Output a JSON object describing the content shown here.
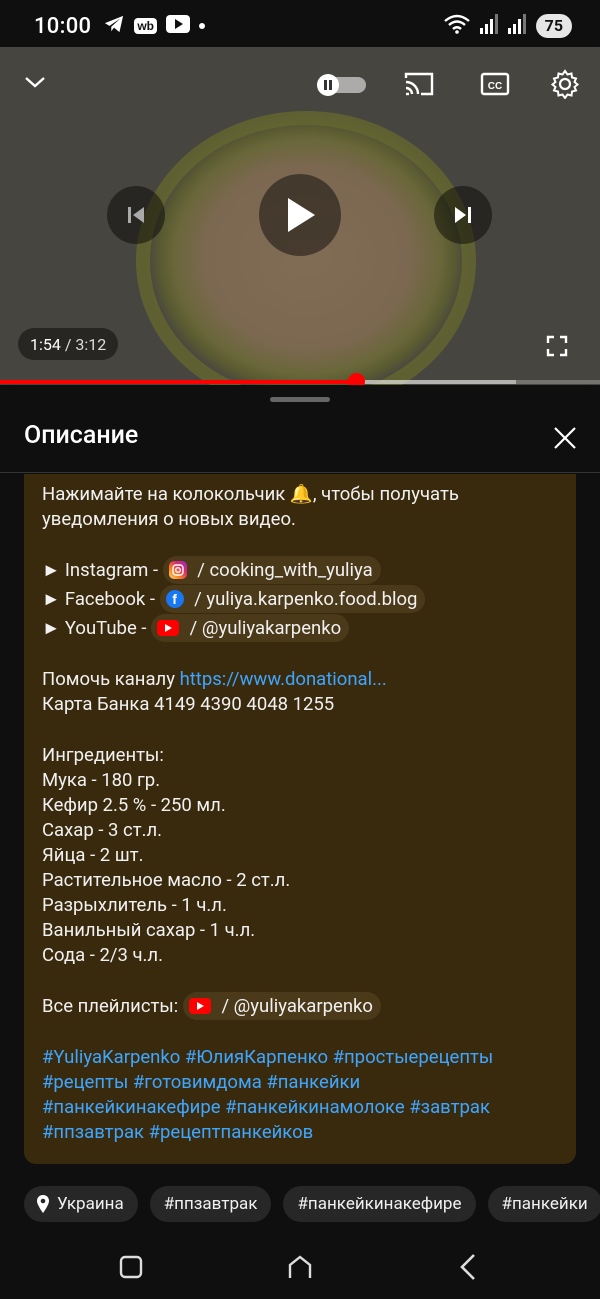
{
  "status_bar": {
    "time": "10:00",
    "battery": "75"
  },
  "player": {
    "current_time": "1:54",
    "separator": " / ",
    "duration": "3:12",
    "played_fraction": 0.593,
    "buffered_fraction": 0.86
  },
  "description_sheet": {
    "title": "Описание",
    "text": {
      "bell_line1": "Нажимайте на колокольчик 🔔, чтобы получать",
      "bell_line2": "уведомления о новых видео.",
      "instagram_prefix": "► Instagram - ",
      "instagram_handle": " / cooking_with_yuliya",
      "facebook_prefix": "► Facebook - ",
      "facebook_handle": " / yuliya.karpenko.food.blog",
      "youtube_prefix": "► YouTube - ",
      "youtube_handle": " / @yuliyakarpenko",
      "help_label": "Помочь каналу ",
      "help_link": "https://www.donational...",
      "bank_card": "Карта Банка 4149 4390 4048 1255",
      "ingredients_title": "Ингредиенты:",
      "ingredients": [
        "Мука - 180 гр.",
        "Кефир 2.5 % - 250 мл.",
        "Сахар - 3 ст.л.",
        "Яйца - 2 шт.",
        "Растительное масло - 2 ст.л.",
        "Разрыхлитель - 1 ч.л.",
        "Ванильный сахар - 1 ч.л.",
        "Сода - 2/3 ч.л."
      ],
      "playlists_label": "Все плейлисты: ",
      "playlists_handle": " / @yuliyakarpenko",
      "hashtag_lines": [
        "#YuliyaKarpenko #ЮлияКарпенко #простыерецепты",
        "#рецепты #готовимдома #панкейки",
        "#панкейкинакефире #панкейкинамолоке #завтрак",
        "#ппзавтрак #рецептпанкейков"
      ]
    }
  },
  "tag_chips": [
    "Украина",
    "#ппзавтрак",
    "#панкейкинакефире",
    "#панкейки"
  ]
}
